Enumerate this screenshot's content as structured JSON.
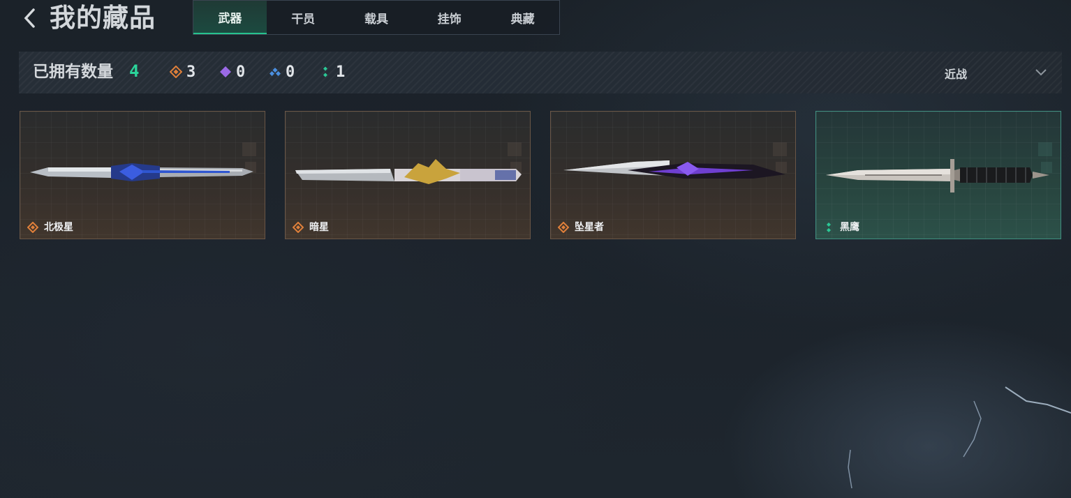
{
  "header": {
    "title": "我的藏品",
    "tabs": [
      {
        "label": "武器",
        "active": true
      },
      {
        "label": "干员",
        "active": false
      },
      {
        "label": "载具",
        "active": false
      },
      {
        "label": "挂饰",
        "active": false
      },
      {
        "label": "典藏",
        "active": false
      }
    ]
  },
  "stats": {
    "owned_label": "已拥有数量",
    "owned_count": "4",
    "rarities": [
      {
        "icon": "orange-diamond-icon",
        "color": "#e0803a",
        "count": "3"
      },
      {
        "icon": "purple-diamond-icon",
        "color": "#9b6ae6",
        "count": "0"
      },
      {
        "icon": "blue-diamond-icon",
        "color": "#4a8fe0",
        "count": "0"
      },
      {
        "icon": "green-dots-icon",
        "color": "#2bc795",
        "count": "1"
      }
    ],
    "filter": {
      "value": "近战"
    }
  },
  "items": [
    {
      "name": "北极星",
      "rarity_color": "#e0803a",
      "weapon": "knife-blue-icon",
      "selected": false
    },
    {
      "name": "暗星",
      "rarity_color": "#e0803a",
      "weapon": "knife-gold-icon",
      "selected": false
    },
    {
      "name": "坠星者",
      "rarity_color": "#e0803a",
      "weapon": "knife-purple-icon",
      "selected": false
    },
    {
      "name": "黑鹰",
      "rarity_color": "#2bc795",
      "weapon": "knife-dagger-icon",
      "selected": true
    }
  ],
  "colors": {
    "accent": "#27c28e",
    "orange": "#e0803a",
    "teal": "#2bc795"
  }
}
